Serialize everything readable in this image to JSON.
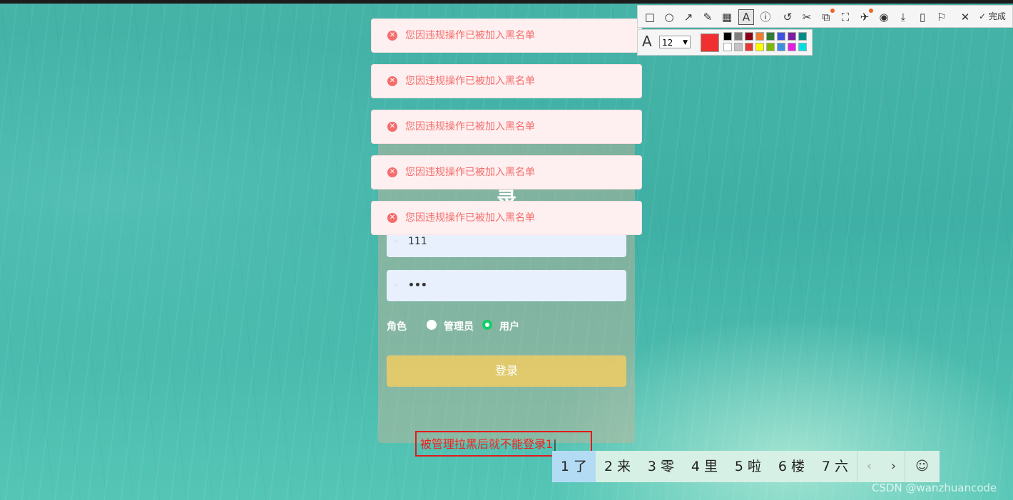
{
  "login": {
    "title": "录",
    "username_value": "111",
    "password_value": "•••",
    "role_label": "角色",
    "role_options": [
      "管理员",
      "用户"
    ],
    "role_selected": "用户",
    "submit_label": "登录"
  },
  "messages": [
    {
      "text": "您因违规操作已被加入黑名单"
    },
    {
      "text": "您因违规操作已被加入黑名单"
    },
    {
      "text": "您因违规操作已被加入黑名单"
    },
    {
      "text": "您因违规操作已被加入黑名单"
    },
    {
      "text": "您因违规操作已被加入黑名单"
    }
  ],
  "screenshot_toolbar": {
    "tools": [
      "rectangle-icon",
      "ellipse-icon",
      "arrow-icon",
      "pencil-icon",
      "mosaic-icon",
      "text-icon",
      "number-icon",
      "undo-icon",
      "crop-icon",
      "ocr-icon",
      "scroll-capture-icon",
      "pin-icon",
      "record-icon",
      "download-icon",
      "long-screenshot-icon",
      "bookmark-icon",
      "close-icon",
      "check-icon"
    ],
    "active_tool": "text-icon",
    "done_label": "完成",
    "font_size": "12",
    "current_color": "#f03030",
    "palette": [
      "#000000",
      "#7f7f7f",
      "#880015",
      "#ed7d31",
      "#2e7d32",
      "#3f51e0",
      "#7b1fa2",
      "#008b8b",
      "#ffffff",
      "#c3c3c3",
      "#e53935",
      "#ffff00",
      "#7fba00",
      "#3f8fe0",
      "#e020e0",
      "#00e0e0"
    ]
  },
  "annotation": {
    "text": "被管理拉黑后就不能登录1"
  },
  "ime": {
    "candidates": [
      "1 了",
      "2 来",
      "3 零",
      "4 里",
      "5 啦",
      "6 楼",
      "7 六"
    ],
    "selected_index": 0,
    "prev": "‹",
    "next": "›",
    "emoji": "☺"
  },
  "watermark": "CSDN @wanzhuancode"
}
